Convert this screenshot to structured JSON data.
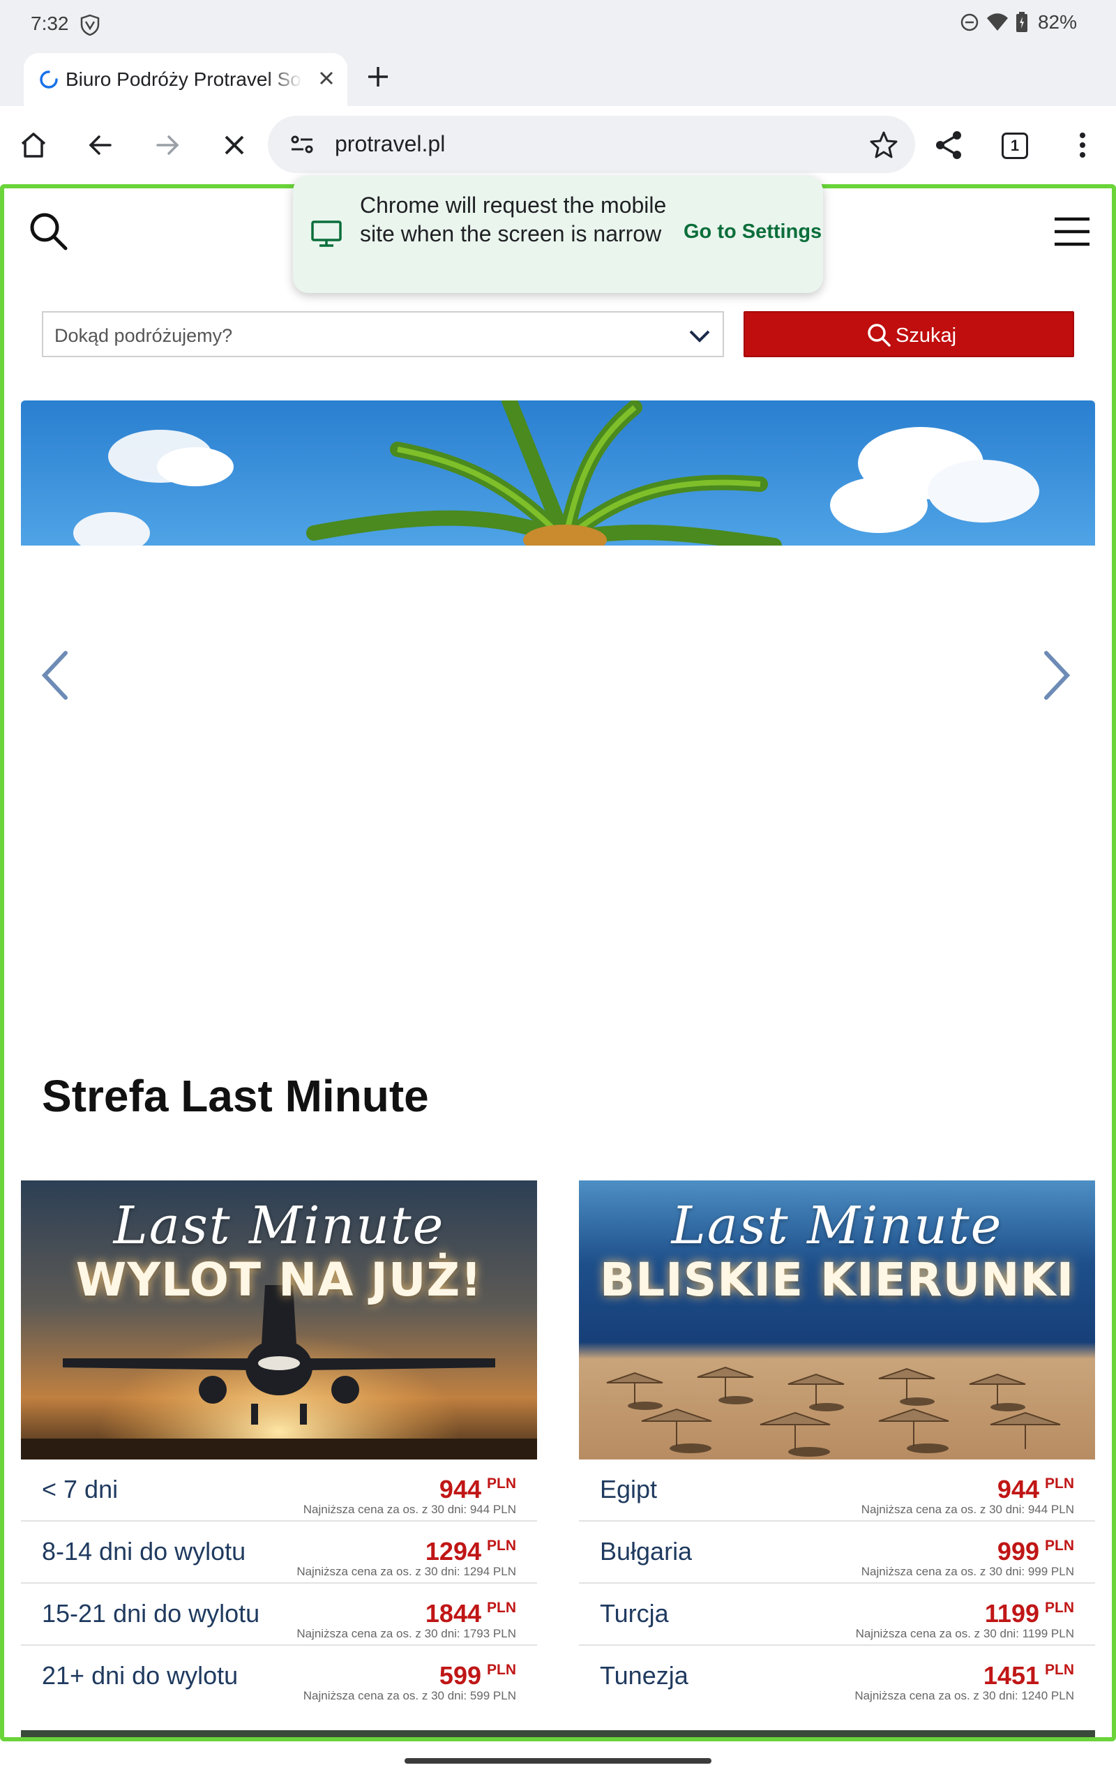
{
  "status_bar": {
    "time": "7:32",
    "battery": "82%"
  },
  "browser": {
    "tab_title": "Biuro Podróży Protravel Sochaczew",
    "url": "protravel.pl",
    "tab_count": "1",
    "popup": {
      "message": "Chrome will request the mobile site when the screen is narrow",
      "action": "Go to Settings"
    }
  },
  "site": {
    "destination_placeholder": "Dokąd podróżujemy?",
    "search_button": "Szukaj",
    "section_title": "Strefa Last Minute",
    "cards": [
      {
        "script": "Last Minute",
        "headline": "WYLOT NA JUŻ!",
        "rows": [
          {
            "label": "< 7 dni",
            "price": "944",
            "currency": "PLN",
            "note": "Najniższa cena za os. z 30 dni: 944 PLN"
          },
          {
            "label": "8-14 dni do wylotu",
            "price": "1294",
            "currency": "PLN",
            "note": "Najniższa cena za os. z 30 dni: 1294 PLN"
          },
          {
            "label": "15-21 dni do wylotu",
            "price": "1844",
            "currency": "PLN",
            "note": "Najniższa cena za os. z 30 dni: 1793 PLN"
          },
          {
            "label": "21+ dni do wylotu",
            "price": "599",
            "currency": "PLN",
            "note": "Najniższa cena za os. z 30 dni: 599 PLN"
          }
        ]
      },
      {
        "script": "Last Minute",
        "headline": "BLISKIE KIERUNKI",
        "rows": [
          {
            "label": "Egipt",
            "price": "944",
            "currency": "PLN",
            "note": "Najniższa cena za os. z 30 dni: 944 PLN"
          },
          {
            "label": "Bułgaria",
            "price": "999",
            "currency": "PLN",
            "note": "Najniższa cena za os. z 30 dni: 999 PLN"
          },
          {
            "label": "Turcja",
            "price": "1199",
            "currency": "PLN",
            "note": "Najniższa cena za os. z 30 dni: 1199 PLN"
          },
          {
            "label": "Tunezja",
            "price": "1451",
            "currency": "PLN",
            "note": "Najniższa cena za os. z 30 dni: 1240 PLN"
          }
        ]
      }
    ]
  },
  "colors": {
    "accent_red": "#c00d0d",
    "frame_green": "#6ad43a",
    "price_red": "#c01616",
    "link_green": "#0b6e3a"
  }
}
